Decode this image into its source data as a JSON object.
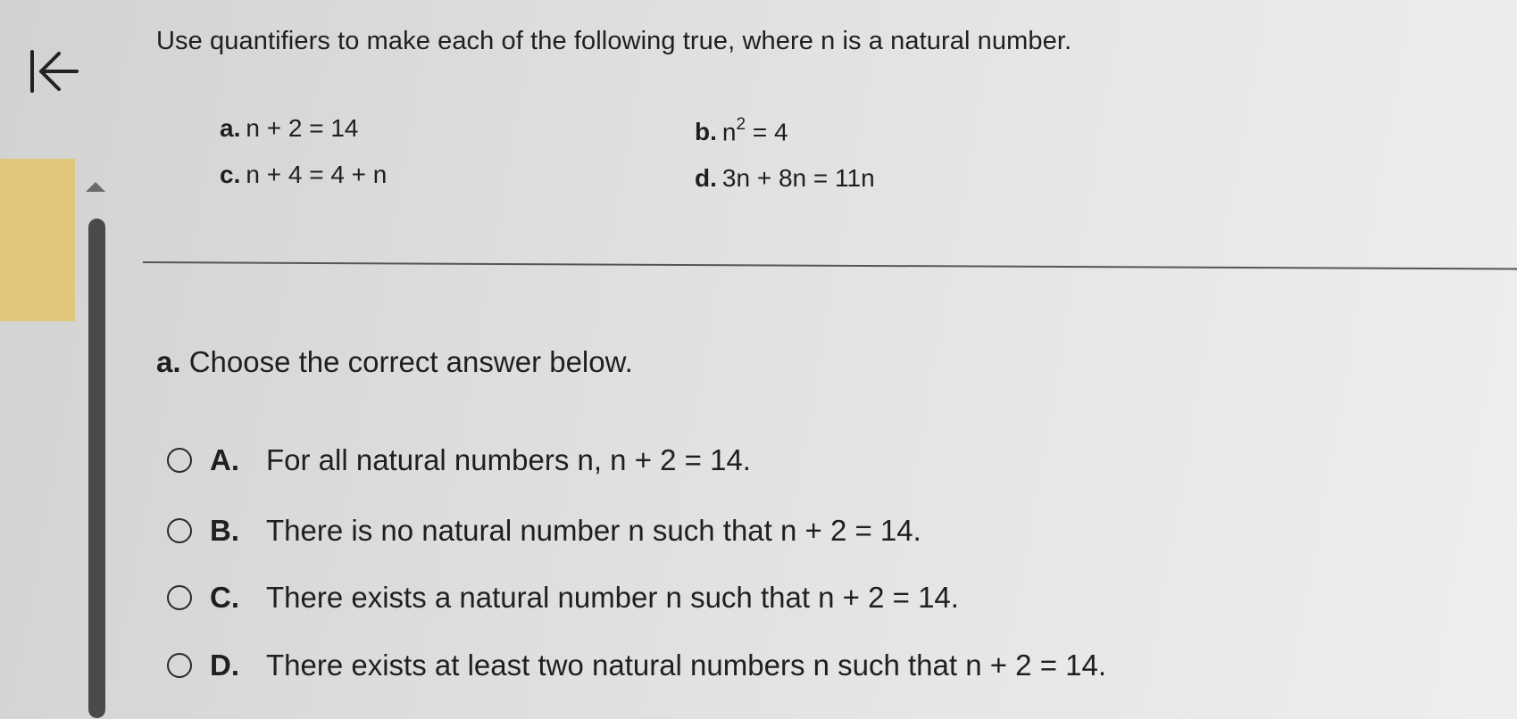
{
  "question": {
    "text": "Use quantifiers to make each of the following true, where n is a natural number."
  },
  "parts": {
    "a": {
      "label": "a.",
      "expr": "n + 2 = 14"
    },
    "b": {
      "label": "b.",
      "base": "n",
      "exponent": "2",
      "rest": " = 4"
    },
    "c": {
      "label": "c.",
      "expr": "n + 4 = 4 + n"
    },
    "d": {
      "label": "d.",
      "expr": "3n + 8n = 11n"
    }
  },
  "answer_section": {
    "label": "a.",
    "prompt": "Choose the correct answer below."
  },
  "choices": [
    {
      "letter": "A.",
      "text": "For all natural numbers n, n + 2 = 14."
    },
    {
      "letter": "B.",
      "text": "There is no natural number n such that n + 2 = 14."
    },
    {
      "letter": "C.",
      "text": "There exists a natural number n such that n + 2 = 14."
    },
    {
      "letter": "D.",
      "text": "There exists at least two natural numbers n such that n + 2 = 14."
    }
  ],
  "icons": {
    "back": "back-to-start-icon",
    "scroll": "scroll-up-arrow-icon"
  },
  "colors": {
    "text": "#1f1f21",
    "highlight": "#e2c46a",
    "scrollbar": "#4a4a4a"
  }
}
